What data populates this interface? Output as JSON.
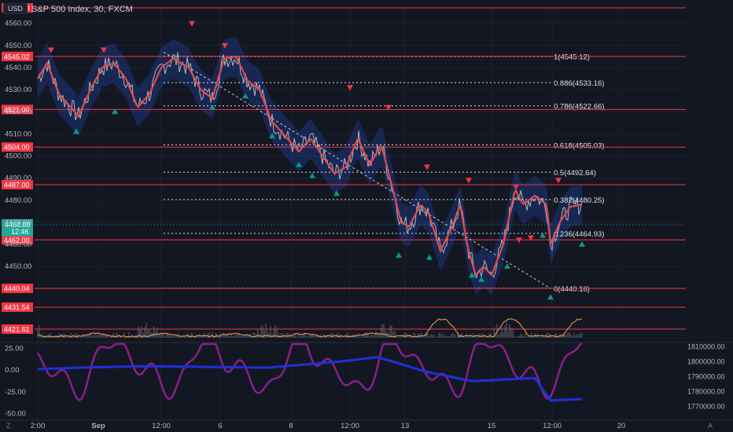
{
  "header": {
    "currency": "USD",
    "title": "S&P 500 Index, 30, FXCM"
  },
  "colors": {
    "bg": "#131722",
    "red": "#f23645",
    "green": "#089981",
    "ema": "#e24b4b",
    "price": "#b2b5be",
    "band": "#2962ff",
    "orange": "#f0a050",
    "purple": "#8a1f8a",
    "blue": "#1e30d8"
  },
  "price_axis": {
    "min": 4417,
    "max": 4567,
    "ticks": [
      "4560.00",
      "4550.00",
      "4540.00",
      "4530.00",
      "4520.00",
      "4510.00",
      "4500.00",
      "4490.00",
      "4480.00",
      "4470.00",
      "4460.00",
      "4450.00"
    ]
  },
  "levels": [
    {
      "label": "4567.00",
      "value": 4567.0
    },
    {
      "label": "4545.02",
      "value": 4545.02
    },
    {
      "label": "4521.00",
      "value": 4521.0
    },
    {
      "label": "4504.00",
      "value": 4504.0
    },
    {
      "label": "4487.00",
      "value": 4487.0
    },
    {
      "label": "4462.00",
      "value": 4462.0
    },
    {
      "label": "4440.04",
      "value": 4440.04
    },
    {
      "label": "4431.54",
      "value": 4431.54
    },
    {
      "label": "4421.61",
      "value": 4421.61
    }
  ],
  "current_price": {
    "value": "4468.88",
    "countdown": "12:46",
    "level": 4468.88
  },
  "fibonacci": [
    {
      "label": "1(4545.12)",
      "value": 4545.12
    },
    {
      "label": "0.886(4533.16)",
      "value": 4533.16
    },
    {
      "label": "0.786(4522.66)",
      "value": 4522.66
    },
    {
      "label": "0.618(4505.03)",
      "value": 4505.03
    },
    {
      "label": "0.5(4492.64)",
      "value": 4492.64
    },
    {
      "label": "0.382(4480.25)",
      "value": 4480.25
    },
    {
      "label": "0.236(4464.93)",
      "value": 4464.93
    },
    {
      "label": "0(4440.16)",
      "value": 4440.16
    }
  ],
  "oscillator": {
    "left_ticks": [
      {
        "label": "25.00",
        "value": 25
      },
      {
        "label": "0.00",
        "value": 0
      },
      {
        "label": "-25.00",
        "value": -25
      },
      {
        "label": "-50.00",
        "value": -50
      }
    ],
    "right_ticks": [
      {
        "label": "1810000.00",
        "value": 1810000
      },
      {
        "label": "1800000.00",
        "value": 1800000
      },
      {
        "label": "1790000.00",
        "value": 1790000
      },
      {
        "label": "1780000.00",
        "value": 1780000
      },
      {
        "label": "1770000.00",
        "value": 1770000
      }
    ]
  },
  "time_axis": [
    "2:00",
    "Sep",
    "12:00",
    "6",
    "8",
    "12:00",
    "13",
    "15",
    "12:00",
    "20"
  ],
  "corner": {
    "left": "Z",
    "right": "A"
  }
}
